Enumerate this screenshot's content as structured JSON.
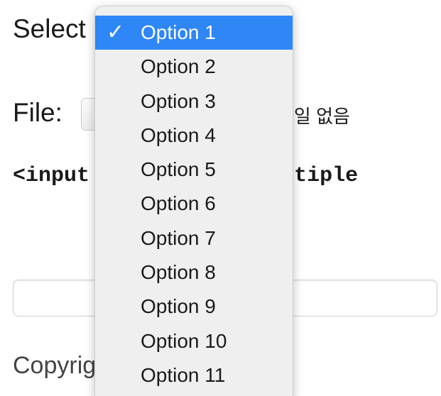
{
  "form": {
    "select_label": "Select",
    "file_label": "File:",
    "file_status": "파일 없음",
    "code_snippet": "<input type=\"file\" multiple",
    "footer": "Copyright Michael Taylor"
  },
  "dropdown": {
    "selected_index": 0,
    "check_mark": "✓",
    "options": [
      "Option 1",
      "Option 2",
      "Option 3",
      "Option 4",
      "Option 5",
      "Option 6",
      "Option 7",
      "Option 8",
      "Option 9",
      "Option 10",
      "Option 11"
    ]
  },
  "colors": {
    "highlight": "#2e86f7",
    "menu_background": "#efefef"
  }
}
